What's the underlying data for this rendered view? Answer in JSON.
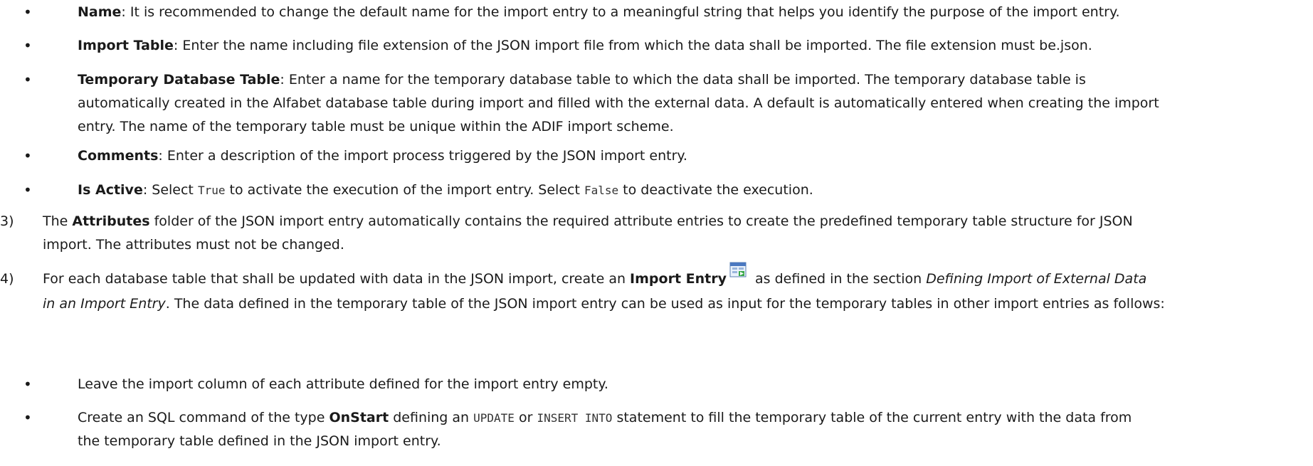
{
  "bullets_top": [
    {
      "term": "Name",
      "text": ": It is recommended to change the default name for the import entry to a meaningful string that helps you identify the purpose of the import entry."
    },
    {
      "term": "Import Table",
      "text": ": Enter the name including file extension of the JSON import file from which the data shall be imported. The file extension must be.json."
    },
    {
      "term": "Temporary Database Table",
      "text_line1": ": Enter a name for the temporary database table to which the data shall be imported. The temporary database table is",
      "text_line2": "automatically created in the Alfabet database table during import and filled with the external data. A default is automatically entered when creating the import",
      "text_line3": "entry. The name of the temporary table must be unique within the ADIF import scheme."
    },
    {
      "term": "Comments",
      "text": ": Enter a description of the import process triggered by the JSON import entry."
    },
    {
      "term": "Is Active",
      "text_a": ": Select ",
      "code_a": "True",
      "text_b": " to activate the execution of the import entry. Select ",
      "code_b": "False",
      "text_c": " to deactivate the execution."
    }
  ],
  "step3": {
    "num": "3)",
    "pre": "The ",
    "bold": "Attributes",
    "post_line1": " folder of the JSON import entry automatically contains the required attribute entries to create the predefined temporary table structure for JSON",
    "line2": "import. The attributes must not be changed."
  },
  "step4": {
    "num": "4)",
    "pre": "For each database table that shall be updated with data in the JSON import, create an ",
    "bold": "Import Entry",
    "mid": " as defined in the section ",
    "italic1": "Defining Import of External Data",
    "italic2": "in an Import Entry",
    "post_line2": ". The data defined in the temporary table of the JSON import entry can be used as input for the temporary tables in other import entries as follows:"
  },
  "bullets_bottom": [
    {
      "text": "Leave the import column of each attribute defined for the import entry empty."
    },
    {
      "pre": "Create an SQL command of the type ",
      "bold": "OnStart",
      "mid1": " defining an ",
      "code1": "UPDATE",
      "mid2": " or ",
      "code2": "INSERT INTO",
      "post_line1": " statement to fill the temporary table of the current entry with the data from",
      "line2": "the temporary table defined in the JSON import entry."
    }
  ],
  "bullet_glyph": "•"
}
